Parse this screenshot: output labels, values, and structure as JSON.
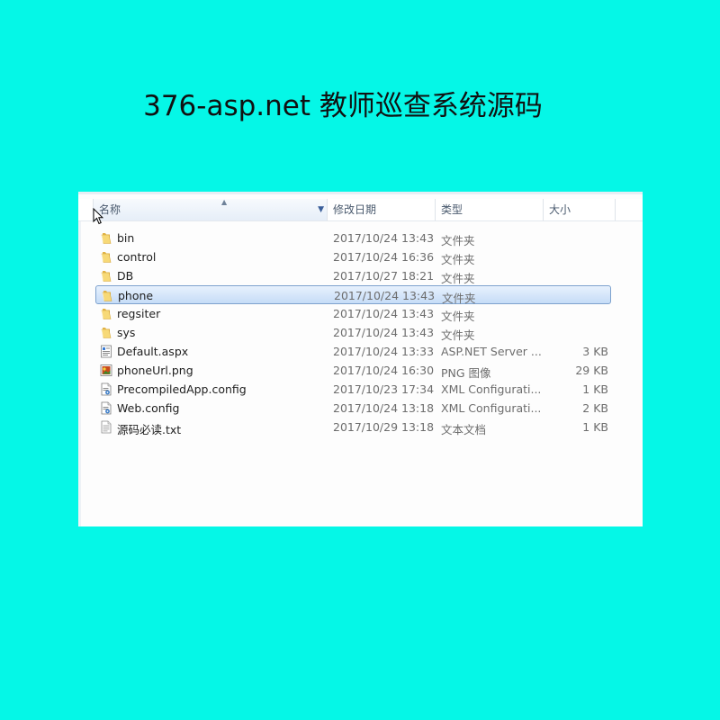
{
  "page": {
    "title": "376-asp.net 教师巡查系统源码"
  },
  "explorer": {
    "columns": {
      "name": "名称",
      "date": "修改日期",
      "type": "类型",
      "size": "大小"
    },
    "selected_index": 3,
    "files": [
      {
        "name": "bin",
        "date": "2017/10/24 13:43",
        "type": "文件夹",
        "size": "",
        "icon": "folder-icon"
      },
      {
        "name": "control",
        "date": "2017/10/24 16:36",
        "type": "文件夹",
        "size": "",
        "icon": "folder-icon"
      },
      {
        "name": "DB",
        "date": "2017/10/27 18:21",
        "type": "文件夹",
        "size": "",
        "icon": "folder-icon"
      },
      {
        "name": "phone",
        "date": "2017/10/24 13:43",
        "type": "文件夹",
        "size": "",
        "icon": "folder-icon"
      },
      {
        "name": "regsiter",
        "date": "2017/10/24 13:43",
        "type": "文件夹",
        "size": "",
        "icon": "folder-icon"
      },
      {
        "name": "sys",
        "date": "2017/10/24 13:43",
        "type": "文件夹",
        "size": "",
        "icon": "folder-icon"
      },
      {
        "name": "Default.aspx",
        "date": "2017/10/24 13:33",
        "type": "ASP.NET Server ...",
        "size": "3 KB",
        "icon": "aspx-file-icon"
      },
      {
        "name": "phoneUrl.png",
        "date": "2017/10/24 16:30",
        "type": "PNG 图像",
        "size": "29 KB",
        "icon": "image-file-icon"
      },
      {
        "name": "PrecompiledApp.config",
        "date": "2017/10/23 17:34",
        "type": "XML Configurati...",
        "size": "1 KB",
        "icon": "config-file-icon"
      },
      {
        "name": "Web.config",
        "date": "2017/10/24 13:18",
        "type": "XML Configurati...",
        "size": "2 KB",
        "icon": "config-file-icon"
      },
      {
        "name": "源码必读.txt",
        "date": "2017/10/29 13:18",
        "type": "文本文档",
        "size": "1 KB",
        "icon": "text-file-icon"
      }
    ]
  },
  "colors": {
    "background": "#05f7e7",
    "selection": "#c6dcf7",
    "selection_border": "#7da2ce"
  }
}
